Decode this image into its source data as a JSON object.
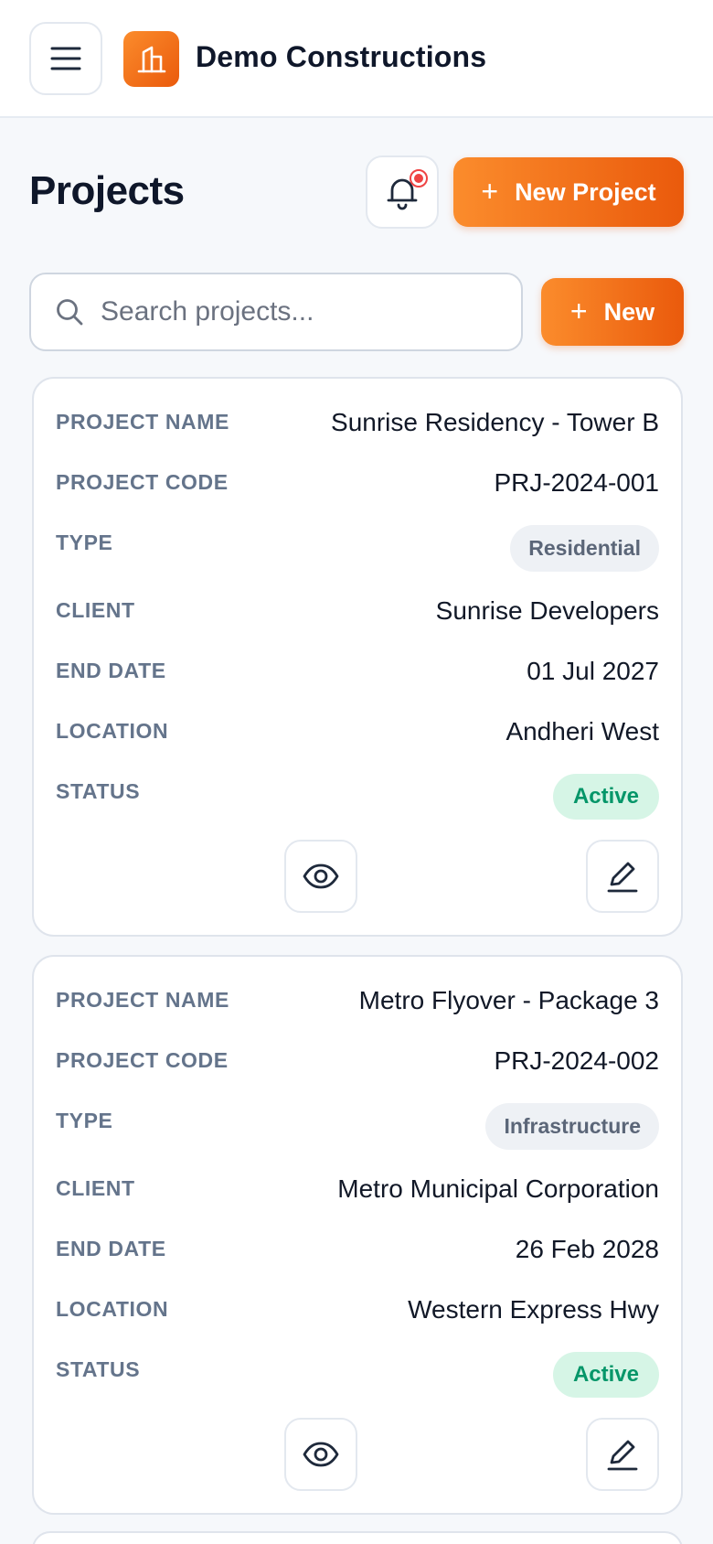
{
  "header": {
    "company": "Demo Constructions"
  },
  "page": {
    "title": "Projects",
    "new_project_label": "New Project",
    "new_label": "New",
    "plus": "+"
  },
  "search": {
    "placeholder": "Search projects...",
    "value": ""
  },
  "labels": {
    "project_name": "PROJECT NAME",
    "project_code": "PROJECT CODE",
    "type": "TYPE",
    "client": "CLIENT",
    "end_date": "END DATE",
    "location": "LOCATION",
    "status": "STATUS"
  },
  "projects": [
    {
      "name": "Sunrise Residency - Tower B",
      "code": "PRJ-2024-001",
      "type": "Residential",
      "client": "Sunrise Developers",
      "end_date": "01 Jul 2027",
      "location": "Andheri West",
      "status": "Active"
    },
    {
      "name": "Metro Flyover - Package 3",
      "code": "PRJ-2024-002",
      "type": "Infrastructure",
      "client": "Metro Municipal Corporation",
      "end_date": "26 Feb 2028",
      "location": "Western Express Hwy",
      "status": "Active"
    }
  ],
  "colors": {
    "accent": "#ea5a0c",
    "accent_light": "#fb8c2c",
    "status_active_bg": "#d6f5e6",
    "status_active_text": "#059669",
    "notification_dot": "#ef4444"
  },
  "icons": {
    "menu": "hamburger-icon",
    "logo": "building-icon",
    "notifications": "bell-icon",
    "search": "search-icon",
    "view": "eye-icon",
    "edit": "pencil-icon"
  }
}
